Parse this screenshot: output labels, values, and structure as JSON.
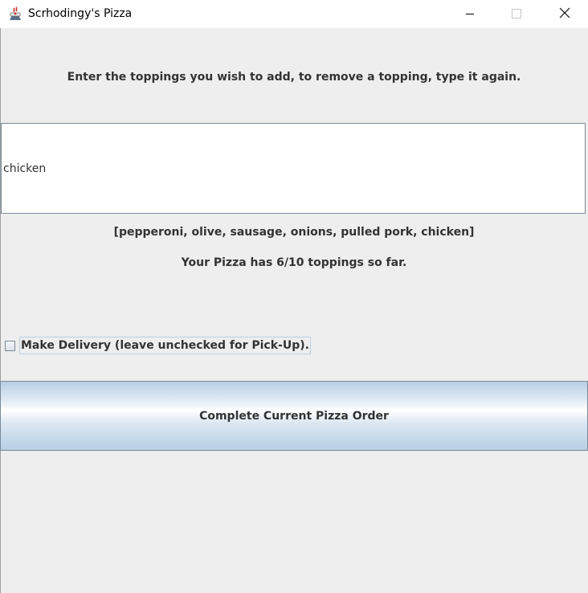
{
  "window": {
    "title": "Scrhodingy's Pizza",
    "icon": "java-coffee-cup-icon",
    "controls": {
      "minimize": "minimize-icon",
      "maximize": "maximize-icon",
      "close": "close-icon"
    }
  },
  "main": {
    "instruction": "Enter the toppings you wish to add, to remove a topping, type it again.",
    "topping_input_value": "chicken",
    "toppings_list": "[pepperoni, olive, sausage, onions, pulled pork, chicken]",
    "toppings_count_text": "Your Pizza has 6/10 toppings so far.",
    "delivery_checkbox": {
      "label": "Make Delivery (leave unchecked for Pick-Up).",
      "checked": false
    },
    "complete_button_label": "Complete Current Pizza Order"
  },
  "colors": {
    "background": "#eeeeee",
    "text": "#333333",
    "border": "#7a8a99",
    "button_gradient_edge": "#b8cfe5"
  }
}
